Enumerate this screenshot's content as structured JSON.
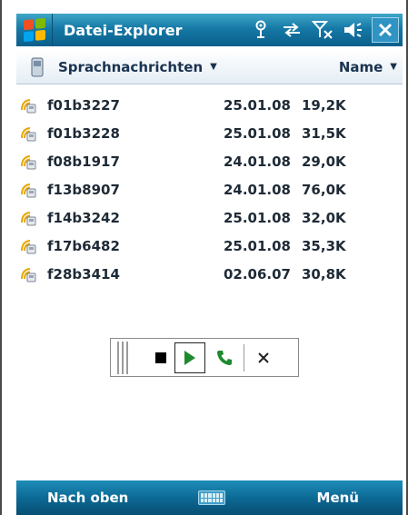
{
  "titlebar": {
    "title": "Datei-Explorer",
    "icons": [
      "windows-start-icon",
      "connectivity-icon",
      "sync-arrows-icon",
      "signal-off-icon",
      "speaker-icon",
      "close-icon"
    ]
  },
  "header": {
    "folder_label": "Sprachnachrichten",
    "sort_label": "Name"
  },
  "files": [
    {
      "name": "f01b3227",
      "date": "25.01.08",
      "size": "19,2K"
    },
    {
      "name": "f01b3228",
      "date": "25.01.08",
      "size": "31,5K"
    },
    {
      "name": "f08b1917",
      "date": "24.01.08",
      "size": "29,0K"
    },
    {
      "name": "f13b8907",
      "date": "24.01.08",
      "size": "76,0K"
    },
    {
      "name": "f14b3242",
      "date": "25.01.08",
      "size": "32,0K"
    },
    {
      "name": "f17b6482",
      "date": "25.01.08",
      "size": "35,3K"
    },
    {
      "name": "f28b3414",
      "date": "02.06.07",
      "size": "30,8K"
    }
  ],
  "player": {
    "buttons": [
      "stop-icon",
      "play-icon",
      "call-icon",
      "close-icon"
    ]
  },
  "softkeys": {
    "left": "Nach oben",
    "right": "Menü"
  },
  "colors": {
    "titlebar": "#1679a6",
    "softbar": "#0d6a96",
    "play_green": "#1e8a2e",
    "call_green": "#1e8a2e"
  }
}
